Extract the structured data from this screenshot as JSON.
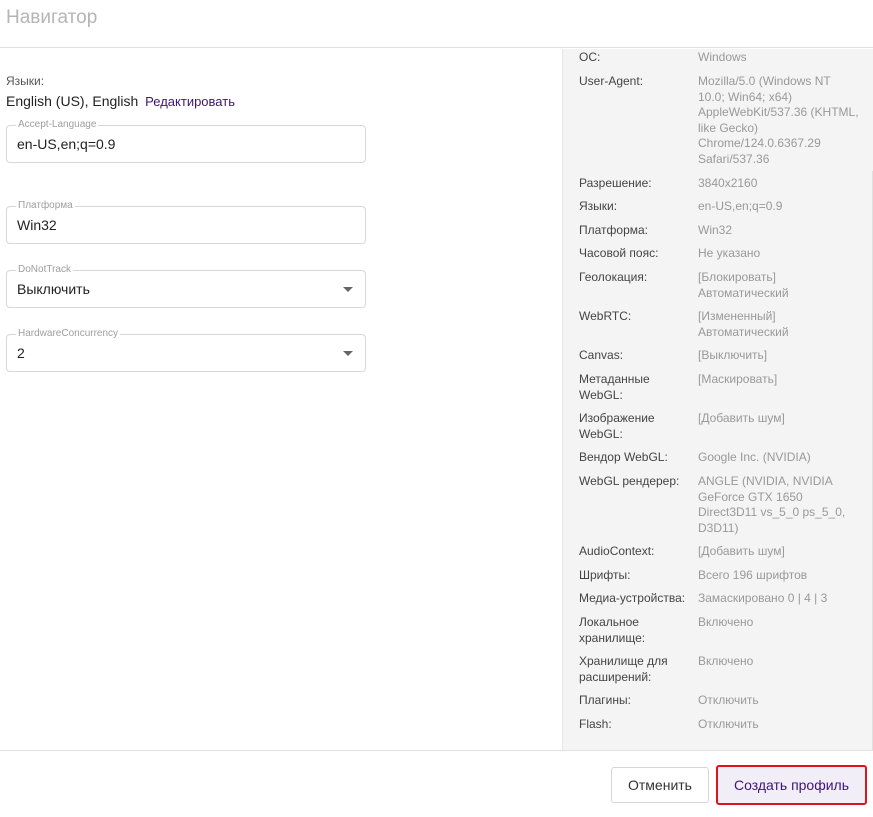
{
  "header": {
    "title": "Навигатор"
  },
  "languages": {
    "label": "Языки:",
    "value": "English (US), English",
    "edit_label": "Редактировать"
  },
  "fields": {
    "accept_language": {
      "label": "Accept-Language",
      "value": "en-US,en;q=0.9"
    },
    "platform": {
      "label": "Платформа",
      "value": "Win32"
    },
    "dnt": {
      "label": "DoNotTrack",
      "value": "Выключить"
    },
    "hwc": {
      "label": "HardwareConcurrency",
      "value": "2"
    }
  },
  "summary": [
    {
      "key": "ОС:",
      "value": "Windows"
    },
    {
      "key": "User-Agent:",
      "value": "Mozilla/5.0 (Windows NT 10.0; Win64; x64) AppleWebKit/537.36 (KHTML, like Gecko) Chrome/124.0.6367.29 Safari/537.36"
    },
    {
      "key": "Разрешение:",
      "value": "3840x2160"
    },
    {
      "key": "Языки:",
      "value": "en-US,en;q=0.9"
    },
    {
      "key": "Платформа:",
      "value": "Win32"
    },
    {
      "key": "Часовой пояс:",
      "value": "Не указано"
    },
    {
      "key": "Геолокация:",
      "value": "[Блокировать] Автоматический"
    },
    {
      "key": "WebRTC:",
      "value": "[Измененный] Автоматический"
    },
    {
      "key": "Canvas:",
      "value": "[Выключить]"
    },
    {
      "key": "Метаданные WebGL:",
      "value": "[Маскировать]"
    },
    {
      "key": "Изображение WebGL:",
      "value": "[Добавить шум]"
    },
    {
      "key": "Вендор WebGL:",
      "value": "Google Inc. (NVIDIA)"
    },
    {
      "key": "WebGL рендерер:",
      "value": "ANGLE (NVIDIA, NVIDIA GeForce GTX 1650 Direct3D11 vs_5_0 ps_5_0, D3D11)"
    },
    {
      "key": "AudioContext:",
      "value": "[Добавить шум]"
    },
    {
      "key": "Шрифты:",
      "value": "Всего 196 шрифтов"
    },
    {
      "key": "Медиа-устройства:",
      "value": "Замаскировано 0 | 4 | 3"
    },
    {
      "key": "Локальное хранилище:",
      "value": "Включено"
    },
    {
      "key": "Хранилище для расширений:",
      "value": "Включено"
    },
    {
      "key": "Плагины:",
      "value": "Отключить"
    },
    {
      "key": "Flash:",
      "value": "Отключить"
    }
  ],
  "footer": {
    "cancel_label": "Отменить",
    "create_label": "Создать профиль"
  },
  "colors": {
    "accent": "#3f1478",
    "highlight": "#e0121b"
  },
  "icons": {
    "dropdown": "chevron-down-icon"
  }
}
